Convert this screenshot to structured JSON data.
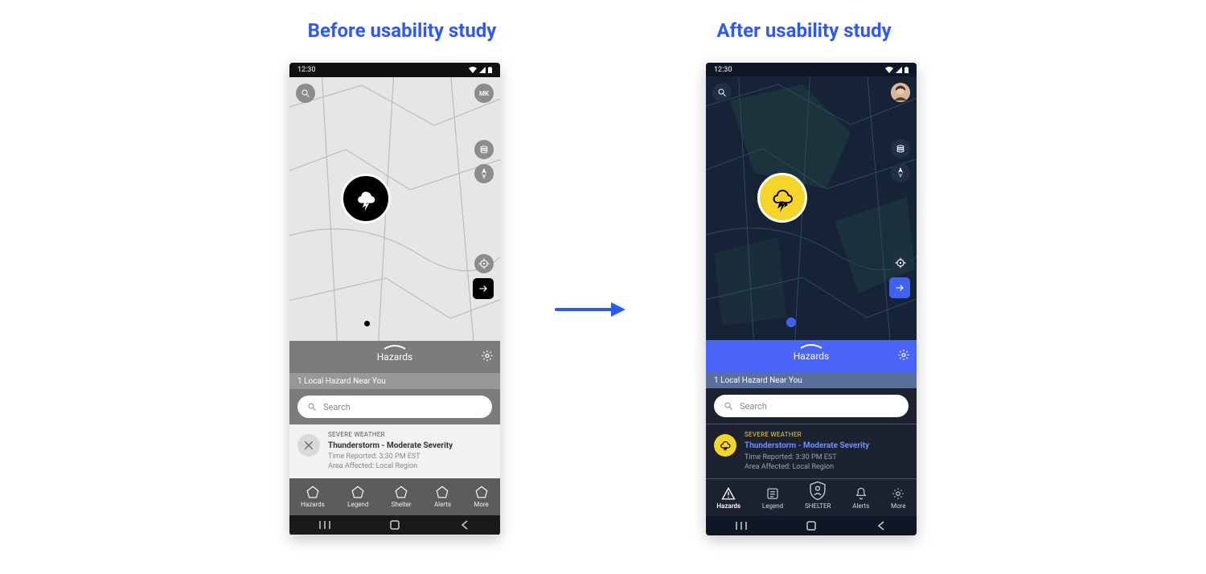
{
  "captions": {
    "before": "Before usability study",
    "after": "After usability study"
  },
  "status": {
    "time": "12:30"
  },
  "panel": {
    "title": "Hazards",
    "subtitle": "1 Local Hazard Near You"
  },
  "search": {
    "placeholder": "Search"
  },
  "alert": {
    "category": "SEVERE WEATHER",
    "title": "Thunderstorm - Moderate Severity",
    "time_line": "Time Reported: 3:30 PM EST",
    "area_line": "Area Affected: Local Region"
  },
  "nav": {
    "hazards": "Hazards",
    "legend": "Legend",
    "shelter_before": "Shelter",
    "shelter_after": "SHELTER",
    "alerts": "Alerts",
    "more": "More"
  },
  "profile_initials": "MK",
  "colors": {
    "accent_blue": "#2d5af6",
    "panel_blue": "#4a64f7",
    "hazard_yellow": "#f6d52a",
    "dark_bg": "#162235"
  }
}
